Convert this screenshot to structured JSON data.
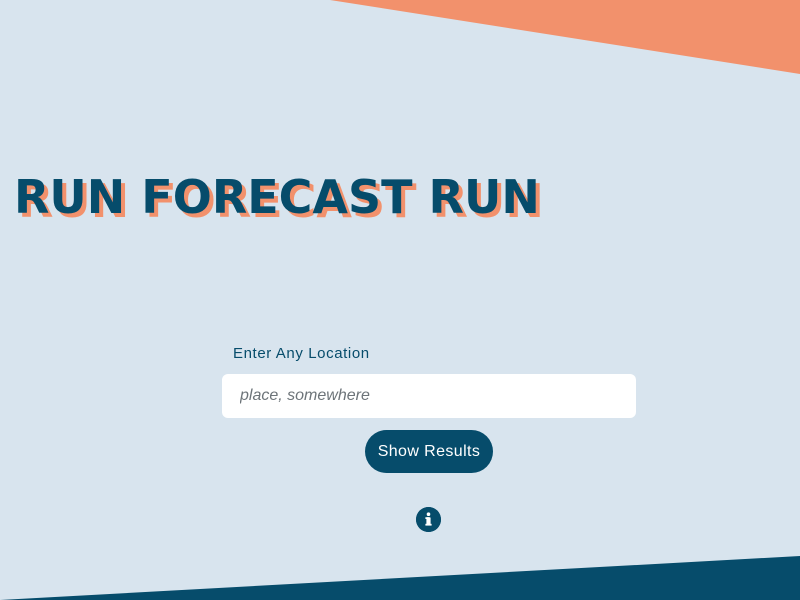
{
  "app": {
    "title": "RUN FORECAST RUN"
  },
  "search": {
    "label": "Enter Any Location",
    "placeholder": "place, somewhere",
    "value": ""
  },
  "actions": {
    "show_results_label": "Show Results",
    "info_icon": "info-icon"
  },
  "colors": {
    "background": "#d8e4ee",
    "primary": "#064c6b",
    "accent": "#f2916c",
    "input_bg": "#ffffff",
    "button_text": "#ffffff"
  }
}
